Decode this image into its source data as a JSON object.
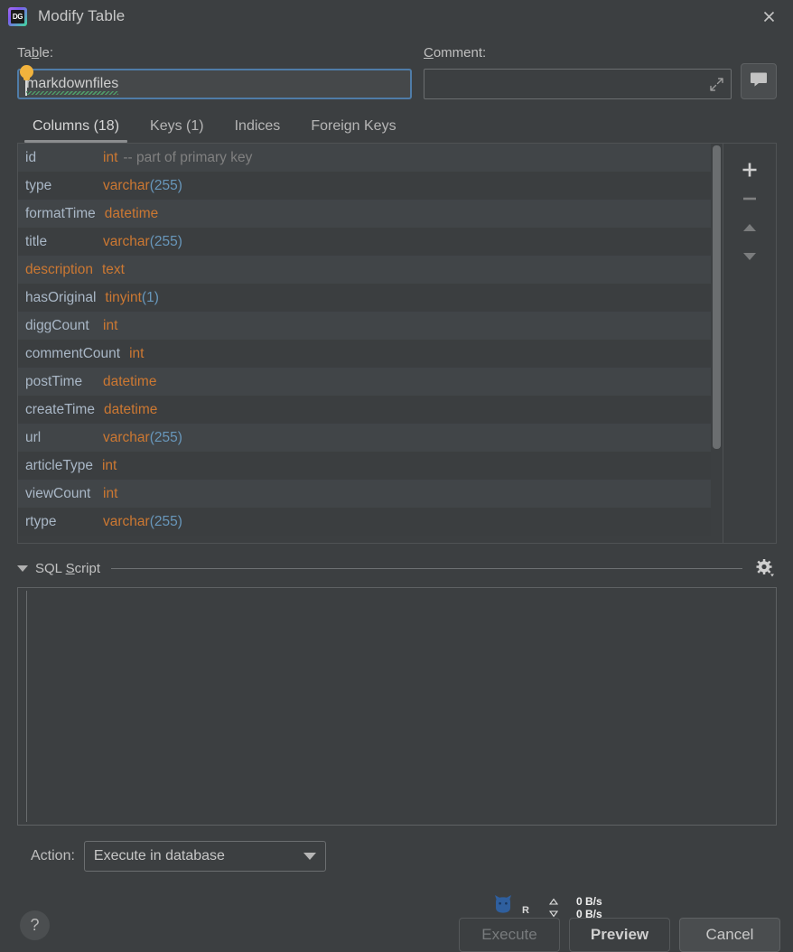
{
  "window": {
    "title": "Modify Table",
    "app_icon": "datagrip-logo-icon",
    "app_icon_text": "DG",
    "close_label": "✕"
  },
  "fields": {
    "table": {
      "label_pre": "Ta",
      "label_mnemonic": "b",
      "label_post": "le:",
      "value": "markdownfiles",
      "bulb_icon": "lightbulb-icon"
    },
    "comment": {
      "label_pre": "",
      "label_mnemonic": "C",
      "label_post": "omment:",
      "value": "",
      "placeholder": "",
      "expand_icon": "expand-arrows-icon",
      "button_icon": "speech-bubble-icon"
    }
  },
  "tabs": [
    {
      "label": "Columns (18)",
      "name": "tab-columns",
      "active": true
    },
    {
      "label": "Keys (1)",
      "name": "tab-keys",
      "active": false
    },
    {
      "label": "Indices",
      "name": "tab-indices",
      "active": false
    },
    {
      "label": "Foreign Keys",
      "name": "tab-foreign-keys",
      "active": false
    }
  ],
  "columns": [
    {
      "name": "id",
      "type": "int",
      "len": "",
      "comment": "-- part of primary key",
      "modified": false
    },
    {
      "name": "type",
      "type": "varchar",
      "len": "(255)",
      "comment": "",
      "modified": false
    },
    {
      "name": "formatTime",
      "type": "datetime",
      "len": "",
      "comment": "",
      "modified": false
    },
    {
      "name": "title",
      "type": "varchar",
      "len": "(255)",
      "comment": "",
      "modified": false
    },
    {
      "name": "description",
      "type": "text",
      "len": "",
      "comment": "",
      "modified": true
    },
    {
      "name": "hasOriginal",
      "type": "tinyint",
      "len": "(1)",
      "comment": "",
      "modified": false
    },
    {
      "name": "diggCount",
      "type": "int",
      "len": "",
      "comment": "",
      "modified": false
    },
    {
      "name": "commentCount",
      "type": "int",
      "len": "",
      "comment": "",
      "modified": false
    },
    {
      "name": "postTime",
      "type": "datetime",
      "len": "",
      "comment": "",
      "modified": false
    },
    {
      "name": "createTime",
      "type": "datetime",
      "len": "",
      "comment": "",
      "modified": false
    },
    {
      "name": "url",
      "type": "varchar",
      "len": "(255)",
      "comment": "",
      "modified": false
    },
    {
      "name": "articleType",
      "type": "int",
      "len": "",
      "comment": "",
      "modified": false
    },
    {
      "name": "viewCount",
      "type": "int",
      "len": "",
      "comment": "",
      "modified": false
    },
    {
      "name": "rtype",
      "type": "varchar",
      "len": "(255)",
      "comment": "",
      "modified": false
    }
  ],
  "side_toolbar": [
    {
      "name": "add-column-button",
      "icon": "plus-icon",
      "enabled": true
    },
    {
      "name": "remove-column-button",
      "icon": "minus-icon",
      "enabled": false
    },
    {
      "name": "move-up-button",
      "icon": "triangle-up-icon",
      "enabled": false
    },
    {
      "name": "move-down-button",
      "icon": "triangle-down-icon",
      "enabled": false
    }
  ],
  "sql_section": {
    "title_pre": "SQL ",
    "title_mnemonic": "S",
    "title_post": "cript",
    "expanded": true,
    "script": "",
    "settings_icon": "gear-icon"
  },
  "action": {
    "label": "Action:",
    "selected": "Execute in database"
  },
  "bottom": {
    "help_label": "?",
    "buttons": [
      {
        "label": "Execute",
        "name": "execute-button",
        "state": "disabled"
      },
      {
        "label": "Preview",
        "name": "preview-button",
        "state": "default"
      },
      {
        "label": "Cancel",
        "name": "cancel-button",
        "state": "normal"
      }
    ]
  },
  "netspeed_overlay": {
    "icon": "cat-icon",
    "badge": "R",
    "upload_rate": "0 B/s",
    "download_rate": "0 B/s"
  },
  "colors": {
    "background": "#3c3f41",
    "row_even": "#414548",
    "row_odd": "#3b3e40",
    "column_name": "#a9b7c6",
    "type_keyword": "#cc7832",
    "type_length": "#6897bb",
    "comment_gray": "#808080",
    "focus_border": "#4f7ca8",
    "bulb_yellow": "#f2b33d"
  }
}
